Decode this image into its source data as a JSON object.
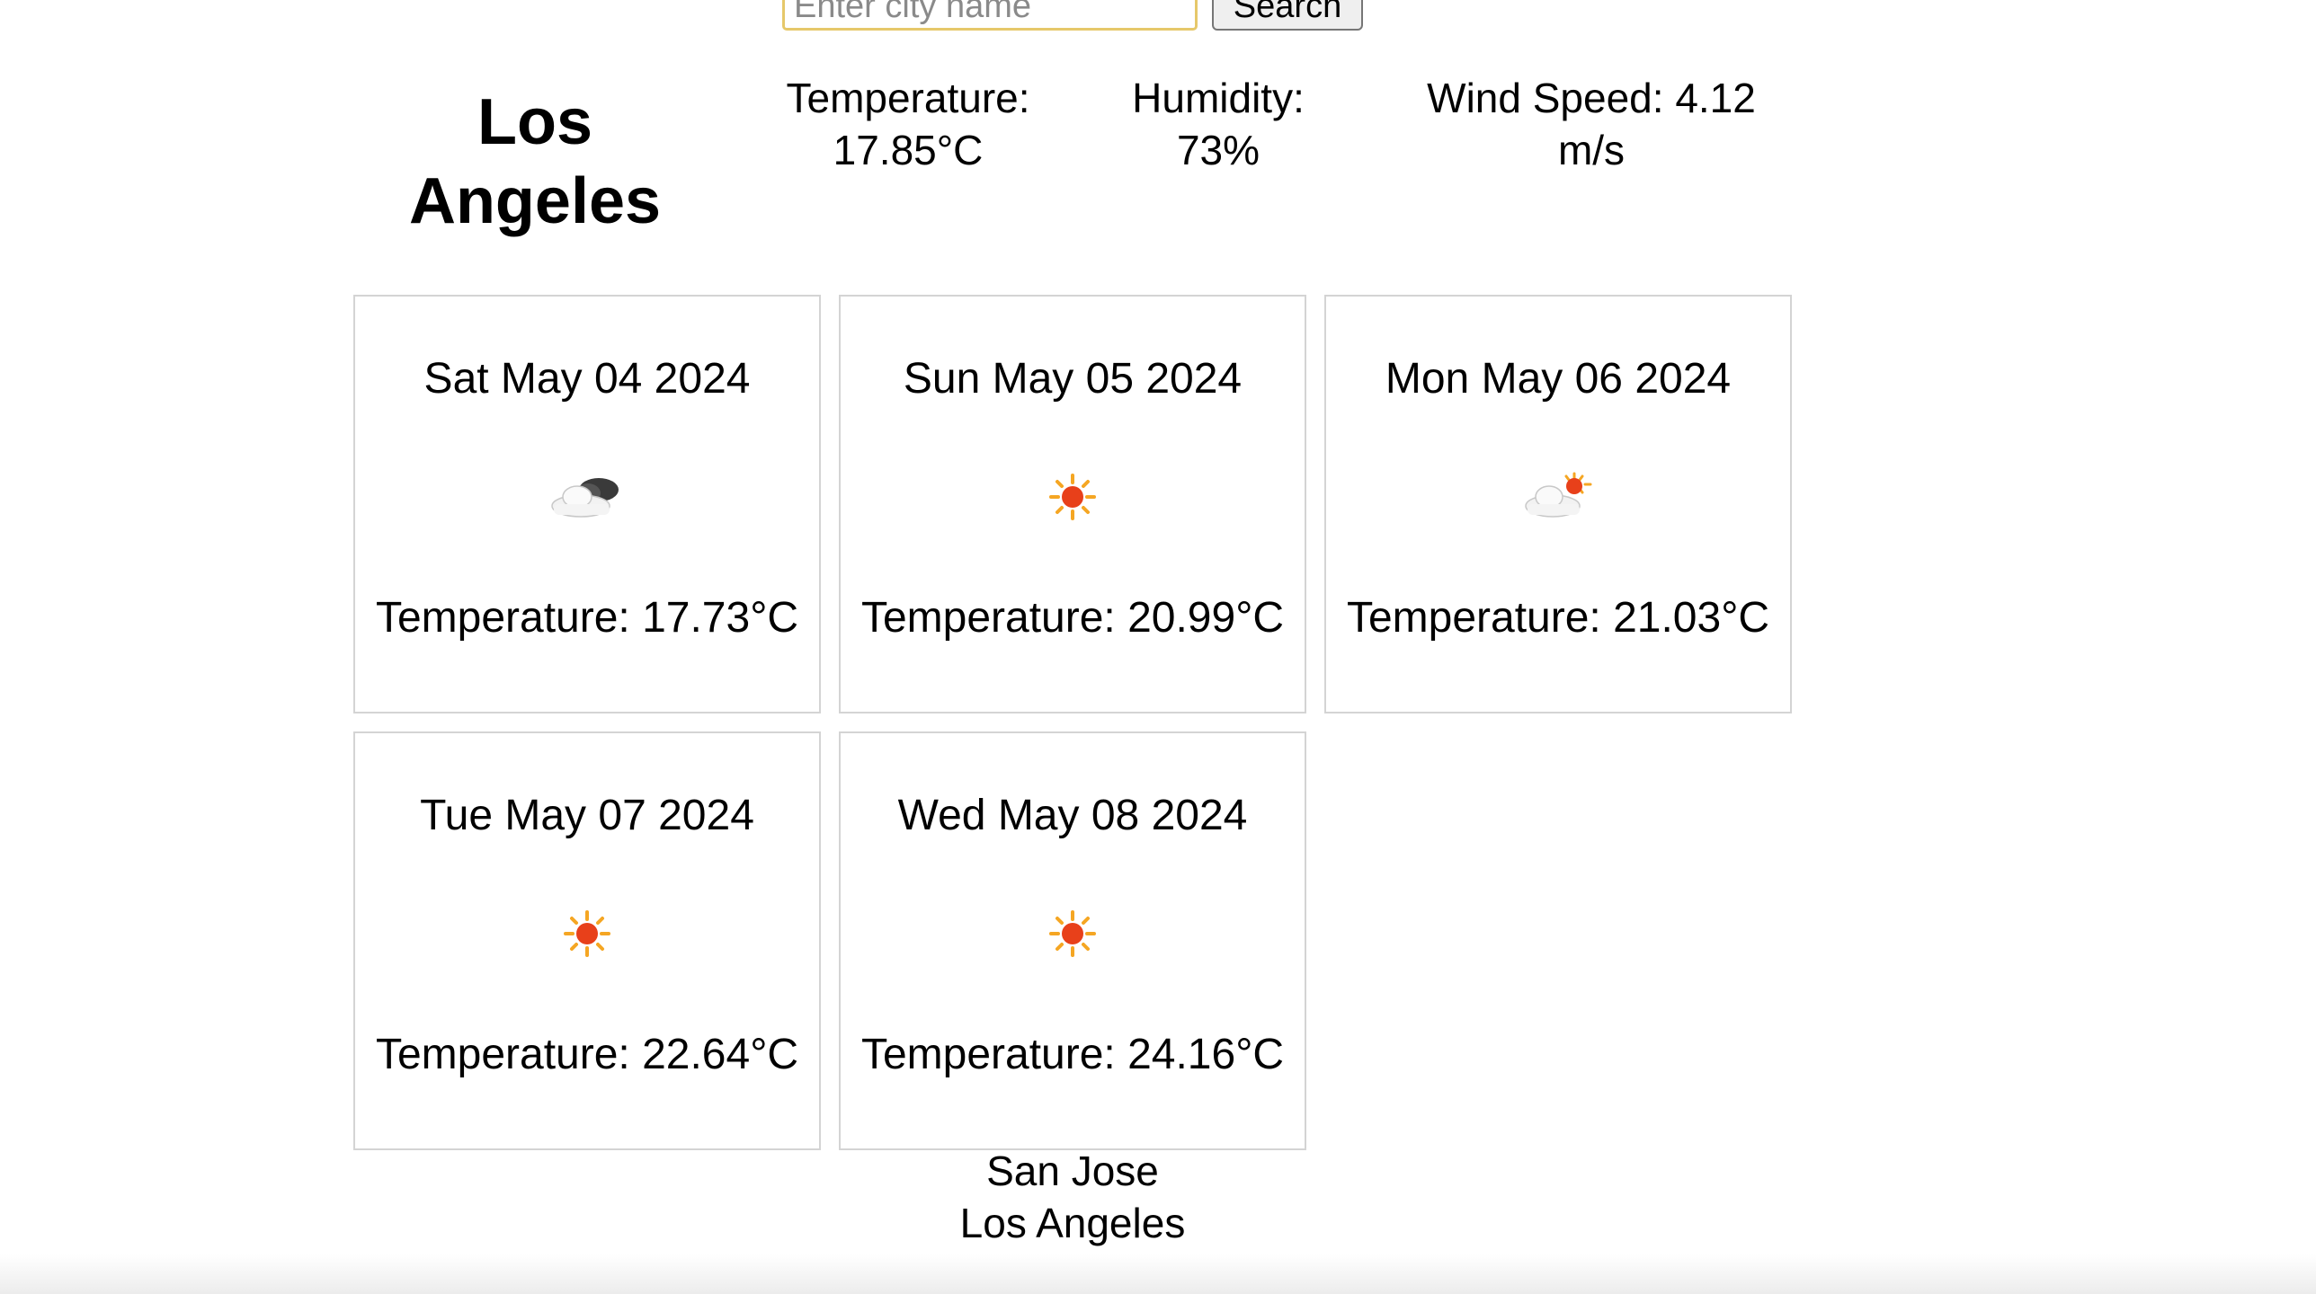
{
  "search": {
    "placeholder": "Enter city name",
    "button_label": "Search"
  },
  "current": {
    "city": "Los Angeles",
    "temperature": "Temperature: 17.85°C",
    "humidity": "Humidity: 73%",
    "wind": "Wind Speed: 4.12 m/s"
  },
  "forecast": [
    {
      "date": "Sat May 04 2024",
      "icon": "cloudy-icon",
      "temperature": "Temperature: 17.73°C"
    },
    {
      "date": "Sun May 05 2024",
      "icon": "sun-icon",
      "temperature": "Temperature: 20.99°C"
    },
    {
      "date": "Mon May 06 2024",
      "icon": "partly-cloudy-icon",
      "temperature": "Temperature: 21.03°C"
    },
    {
      "date": "Tue May 07 2024",
      "icon": "sun-icon",
      "temperature": "Temperature: 22.64°C"
    },
    {
      "date": "Wed May 08 2024",
      "icon": "sun-icon",
      "temperature": "Temperature: 24.16°C"
    }
  ],
  "recent_cities": [
    "San Jose",
    "Los Angeles"
  ],
  "colors": {
    "input_border": "#e6c86a",
    "card_border": "#d4d4d4",
    "sun": "#e8401a",
    "sun_rays": "#f5a623"
  }
}
